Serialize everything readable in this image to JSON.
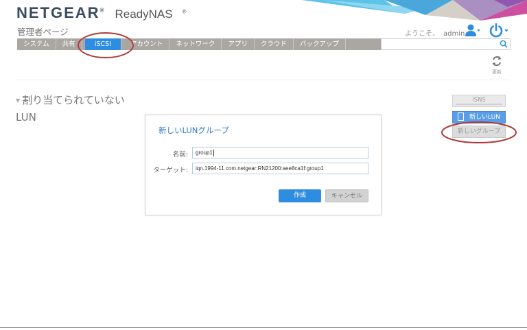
{
  "header": {
    "brand": "NETGEAR",
    "product": "ReadyNAS",
    "page_title": "管理者ページ",
    "welcome": "ようこそ、",
    "username": "admin"
  },
  "nav": {
    "tabs": [
      {
        "label": "システム",
        "active": false
      },
      {
        "label": "共有",
        "active": false
      },
      {
        "label": "iSCSI",
        "active": true
      },
      {
        "label": "アカウント",
        "active": false
      },
      {
        "label": "ネットワーク",
        "active": false
      },
      {
        "label": "アプリ",
        "active": false
      },
      {
        "label": "クラウド",
        "active": false
      },
      {
        "label": "バックアップ",
        "active": false
      }
    ],
    "search_value": ""
  },
  "toolbar": {
    "refresh_label": "更新"
  },
  "section": {
    "title": "割り当てられていないLUN"
  },
  "side_buttons": {
    "isns": "iSNS",
    "new_lun": "新しいLUN",
    "new_group": "新しいグループ"
  },
  "dialog": {
    "title": "新しいLUNグループ",
    "name_label": "名前:",
    "name_value": "group1",
    "target_label": "ターゲット:",
    "target_value": "iqn.1994-11.com.netgear:RN21200:aee8ca1f:group1",
    "create_button": "作成",
    "cancel_button": "キャンセル"
  },
  "colors": {
    "accent": "#2e8de0",
    "nav_bg": "#aaa7a2",
    "annotation": "#b23a3a"
  }
}
